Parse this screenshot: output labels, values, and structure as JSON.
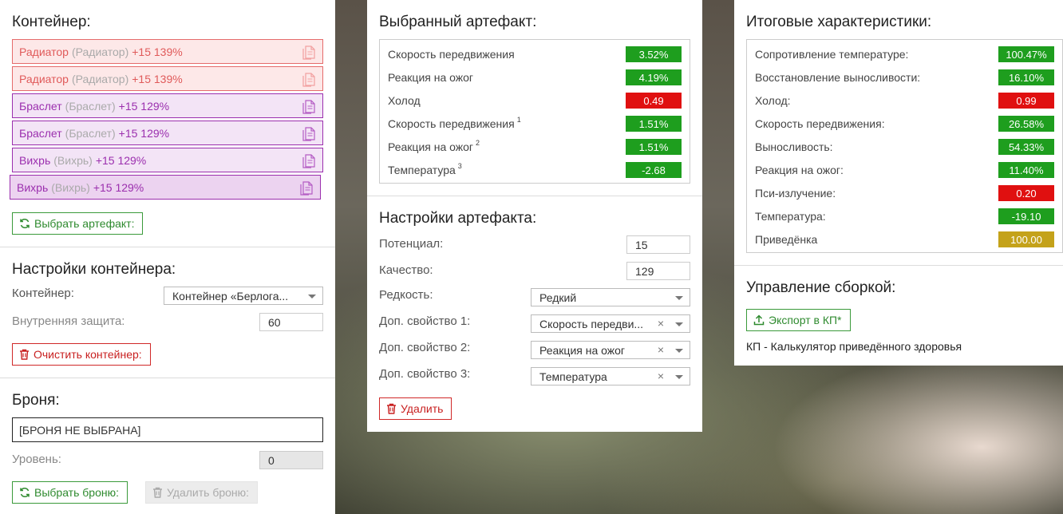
{
  "left": {
    "container_title": "Контейнер:",
    "slots": [
      {
        "name": "Радиатор",
        "alt": "(Радиатор)",
        "bonus": "+15 139%",
        "style": "red"
      },
      {
        "name": "Радиатор",
        "alt": "(Радиатор)",
        "bonus": "+15 139%",
        "style": "red"
      },
      {
        "name": "Браслет",
        "alt": "(Браслет)",
        "bonus": "+15 129%",
        "style": "purple"
      },
      {
        "name": "Браслет",
        "alt": "(Браслет)",
        "bonus": "+15 129%",
        "style": "purple"
      },
      {
        "name": "Вихрь",
        "alt": "(Вихрь)",
        "bonus": "+15 129%",
        "style": "purple"
      },
      {
        "name": "Вихрь",
        "alt": "(Вихрь)",
        "bonus": "+15 129%",
        "style": "purple2"
      }
    ],
    "select_artifact_label": "Выбрать артефакт:",
    "container_settings_title": "Настройки контейнера:",
    "container_label": "Контейнер:",
    "container_value": "Контейнер «Берлога...",
    "inner_protection_label": "Внутренняя защита:",
    "inner_protection_value": "60",
    "clear_container_label": "Очистить контейнер:",
    "armor_title": "Броня:",
    "armor_value": "[БРОНЯ НЕ ВЫБРАНА]",
    "level_label": "Уровень:",
    "level_value": "0",
    "select_armor_label": "Выбрать броню:",
    "delete_armor_label": "Удалить броню:"
  },
  "mid": {
    "selected_title": "Выбранный артефакт:",
    "stats": [
      {
        "label": "Скорость передвижения",
        "sup": "",
        "value": "3.52%",
        "color": "green"
      },
      {
        "label": "Реакция на ожог",
        "sup": "",
        "value": "4.19%",
        "color": "green"
      },
      {
        "label": "Холод",
        "sup": "",
        "value": "0.49",
        "color": "red"
      },
      {
        "label": "Скорость передвижения",
        "sup": "1",
        "value": "1.51%",
        "color": "green"
      },
      {
        "label": "Реакция на ожог",
        "sup": "2",
        "value": "1.51%",
        "color": "green"
      },
      {
        "label": "Температура",
        "sup": "3",
        "value": "-2.68",
        "color": "green"
      }
    ],
    "settings_title": "Настройки артефакта:",
    "potential_label": "Потенциал:",
    "potential_value": "15",
    "quality_label": "Качество:",
    "quality_value": "129",
    "rarity_label": "Редкость:",
    "rarity_value": "Редкий",
    "prop1_label": "Доп. свойство 1:",
    "prop1_value": "Скорость передви...",
    "prop2_label": "Доп. свойство 2:",
    "prop2_value": "Реакция на ожог",
    "prop3_label": "Доп. свойство 3:",
    "prop3_value": "Температура",
    "clear_glyph": "×",
    "delete_label": "Удалить"
  },
  "right": {
    "totals_title": "Итоговые характеристики:",
    "stats": [
      {
        "label": "Сопротивление температуре:",
        "value": "100.47%",
        "color": "green"
      },
      {
        "label": "Восстановление выносливости:",
        "value": "16.10%",
        "color": "green"
      },
      {
        "label": "Холод:",
        "value": "0.99",
        "color": "red"
      },
      {
        "label": "Скорость передвижения:",
        "value": "26.58%",
        "color": "green"
      },
      {
        "label": "Выносливость:",
        "value": "54.33%",
        "color": "green"
      },
      {
        "label": "Реакция на ожог:",
        "value": "11.40%",
        "color": "green"
      },
      {
        "label": "Пси-излучение:",
        "value": "0.20",
        "color": "red"
      },
      {
        "label": "Температура:",
        "value": "-19.10",
        "color": "green"
      },
      {
        "label": "Приведёнка",
        "value": "100.00",
        "color": "gold"
      }
    ],
    "build_title": "Управление сборкой:",
    "export_label": "Экспорт в КП*",
    "footnote": "КП - Калькулятор приведённого здоровья"
  },
  "colors": {
    "green": "#1e9e1e",
    "red": "#e01010",
    "gold": "#c4a21a"
  },
  "icons": {
    "copy": "copy-icon",
    "refresh": "refresh-icon",
    "trash": "trash-icon",
    "upload": "upload-icon",
    "caret": "chevron-down-icon"
  }
}
